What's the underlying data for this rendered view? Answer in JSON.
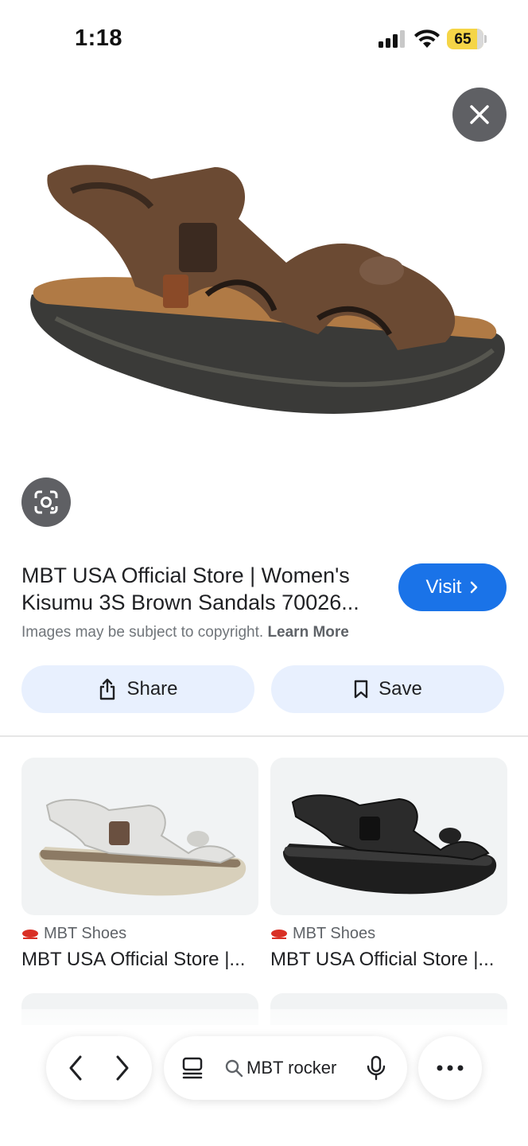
{
  "status_bar": {
    "time": "1:18",
    "battery_percent": "65",
    "battery_color": "#f5d547"
  },
  "hero": {
    "image": "brown-sandal-product-image",
    "close_icon": "close-icon",
    "lens_icon": "google-lens-icon"
  },
  "result": {
    "title_line1": "MBT USA Official Store | Women's",
    "title_line2": "Kisumu 3S Brown Sandals 70026...",
    "visit_label": "Visit",
    "copyright_text": "Images may be subject to copyright.",
    "learn_more_label": "Learn More",
    "share_label": "Share",
    "save_label": "Save",
    "accent_color": "#1a73e8"
  },
  "related": [
    {
      "source": "MBT Shoes",
      "title": "MBT USA Official Store |...",
      "image": "white-sandal-image"
    },
    {
      "source": "MBT Shoes",
      "title": "MBT USA Official Store |...",
      "image": "black-sandal-image"
    }
  ],
  "bottom_bar": {
    "search_text": "MBT rocker",
    "back_icon": "chevron-left-icon",
    "forward_icon": "chevron-right-icon",
    "tabs_icon": "tabs-icon",
    "search_icon": "search-icon",
    "mic_icon": "mic-icon",
    "more_icon": "more-icon"
  }
}
